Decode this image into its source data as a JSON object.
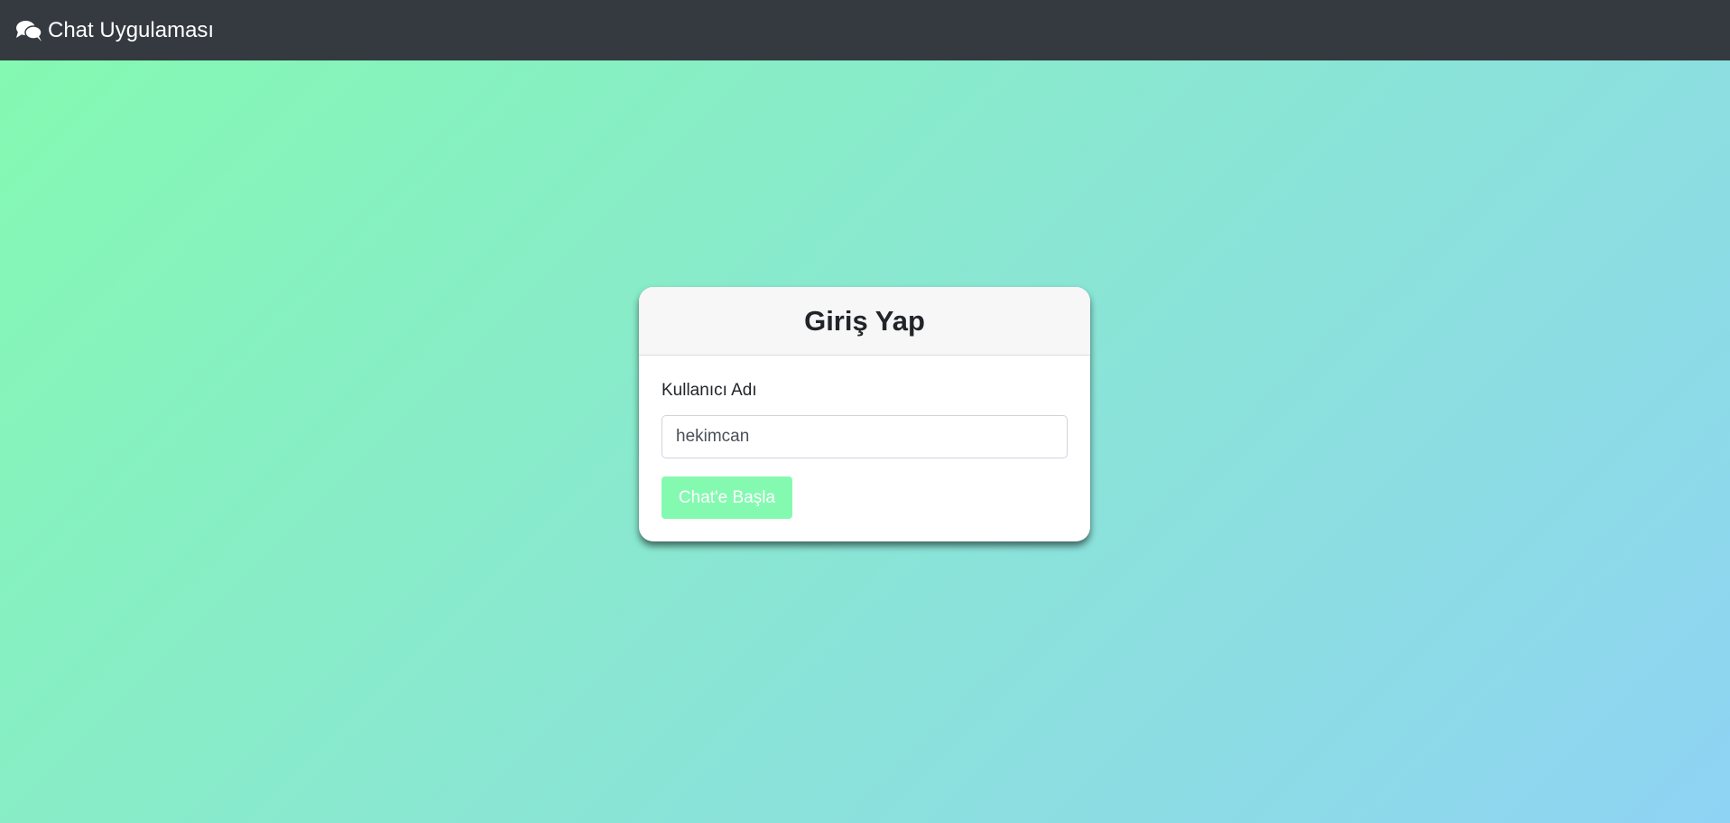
{
  "navbar": {
    "brand_icon": "comments-icon",
    "brand_label": "Chat Uygulaması",
    "background_color": "#343a40"
  },
  "background": {
    "gradient_start": "#84fab0",
    "gradient_end": "#8fd3f4"
  },
  "login_card": {
    "title": "Giriş Yap",
    "username_label": "Kullanıcı Adı",
    "username_value": "hekimcan",
    "submit_label": "Chat'e Başla",
    "submit_color": "#84fab0"
  }
}
